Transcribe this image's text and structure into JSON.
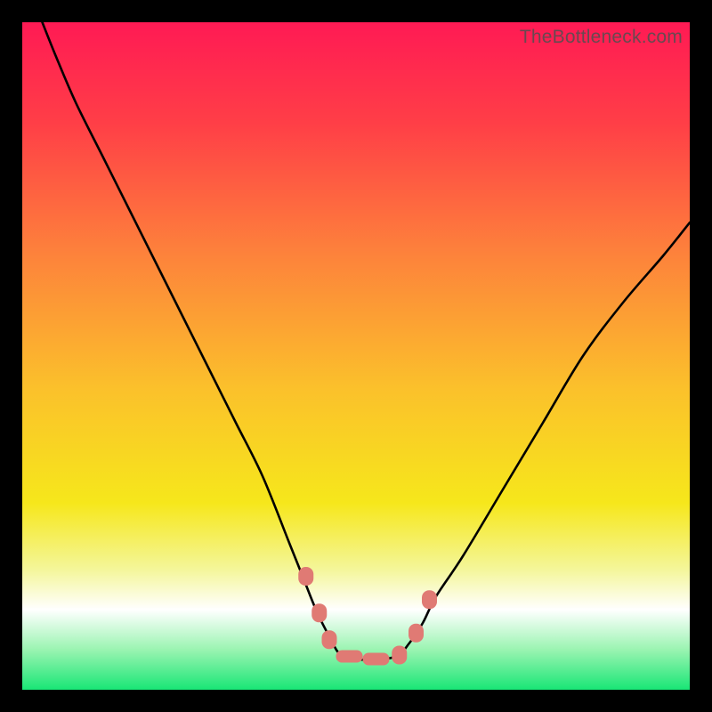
{
  "watermark": "TheBottleneck.com",
  "chart_data": {
    "type": "line",
    "title": "",
    "xlabel": "",
    "ylabel": "",
    "xlim": [
      0,
      100
    ],
    "ylim": [
      0,
      100
    ],
    "grid": false,
    "legend": false,
    "background_gradient": {
      "stops": [
        {
          "pct": 0,
          "color": "#ff1a54"
        },
        {
          "pct": 0.15,
          "color": "#ff3e47"
        },
        {
          "pct": 0.35,
          "color": "#fd833b"
        },
        {
          "pct": 0.55,
          "color": "#fbc12b"
        },
        {
          "pct": 0.72,
          "color": "#f6e71b"
        },
        {
          "pct": 0.82,
          "color": "#f4f69a"
        },
        {
          "pct": 0.88,
          "color": "#ffffff"
        },
        {
          "pct": 0.94,
          "color": "#9af4b1"
        },
        {
          "pct": 1.0,
          "color": "#19e676"
        }
      ]
    },
    "series": [
      {
        "name": "bottleneck-curve",
        "color": "#000000",
        "x": [
          3,
          5,
          8,
          12,
          16,
          20,
          24,
          28,
          32,
          36,
          40,
          42,
          44,
          46,
          48,
          52,
          56,
          58,
          60,
          62,
          66,
          72,
          78,
          84,
          90,
          96,
          100
        ],
        "y": [
          100,
          95,
          88,
          80,
          72,
          64,
          56,
          48,
          40,
          32,
          22,
          17,
          12,
          8,
          5,
          4.5,
          5,
          7,
          10,
          14,
          20,
          30,
          40,
          50,
          58,
          65,
          70
        ]
      }
    ],
    "markers": {
      "shape": "rounded-rect",
      "color": "#e07a74",
      "points": [
        {
          "x": 42.5,
          "y": 17
        },
        {
          "x": 44.5,
          "y": 11.5
        },
        {
          "x": 46.0,
          "y": 7.5
        },
        {
          "x": 49.0,
          "y": 5.0,
          "wide": true
        },
        {
          "x": 53.0,
          "y": 4.6,
          "wide": true
        },
        {
          "x": 56.5,
          "y": 5.2
        },
        {
          "x": 59.0,
          "y": 8.5
        },
        {
          "x": 61.0,
          "y": 13.5
        }
      ]
    }
  }
}
